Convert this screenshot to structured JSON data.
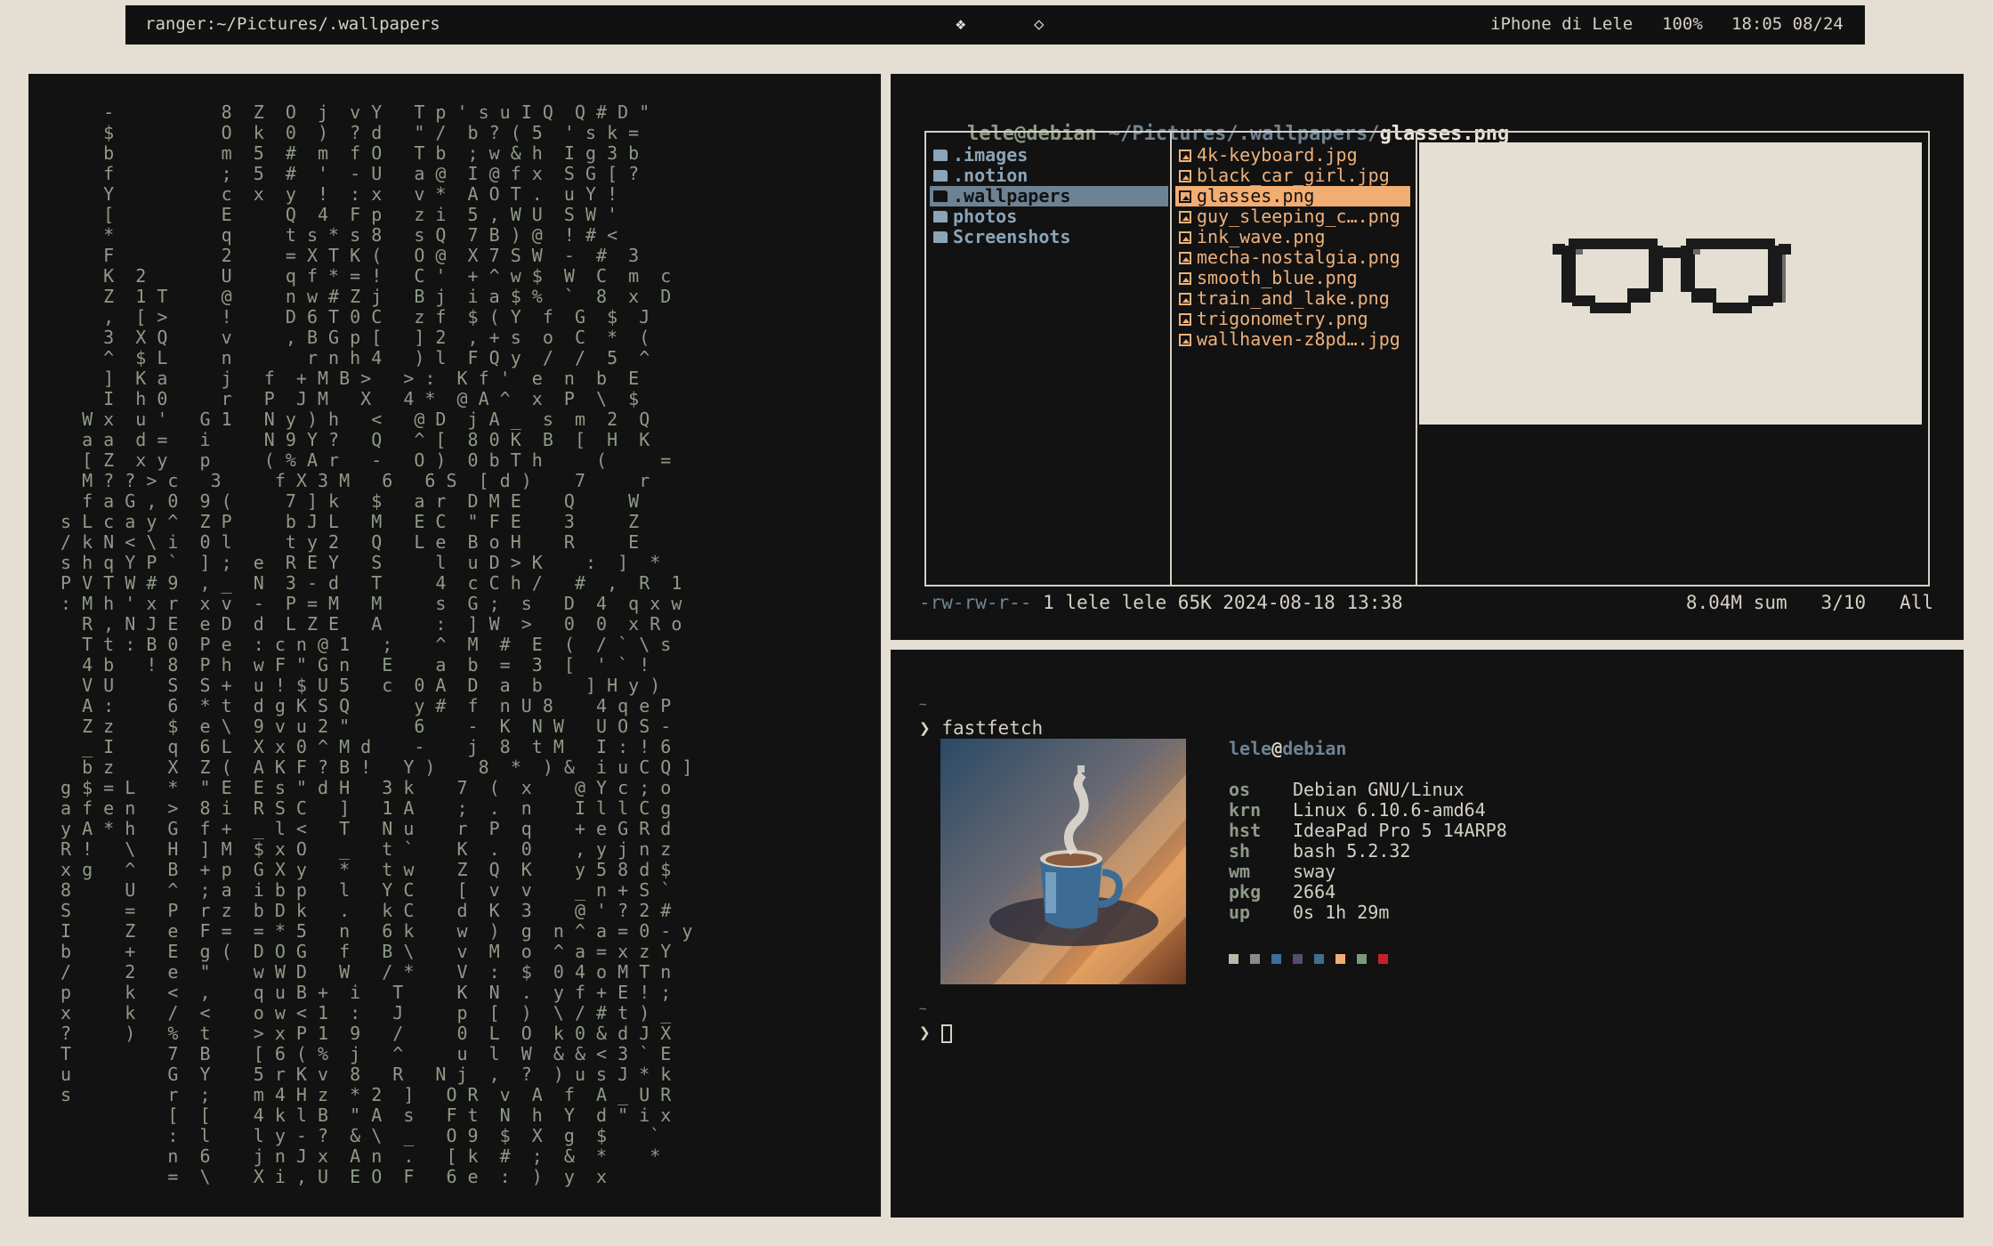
{
  "topbar": {
    "left": "ranger:~/Pictures/.wallpapers",
    "ws_icon_1": "❖",
    "ws_icon_2": "◇",
    "device": "iPhone di Lele",
    "battery": "100%",
    "clock": "18:05 08/24"
  },
  "matrix": {
    "lines": [
      "    -          8  Z  O  j  v Y   T p ' s u I Q  Q # D \"",
      "    $          O  k  0  )  ? d   \" /  b ? ( 5  ' s k =",
      "    b          m  5  #  m  f O   T b  ; w & h  I g 3 b",
      "    f          ;  5  #  '  - U   a @  I @ f x  S G [ ?",
      "    Y          c  x  y  !  : x   v *  A O T .  u Y !",
      "    [          E     Q  4  F p   z i  5 , W U  S W '",
      "    *          q     t s * s 8   s Q  7 B ) @  ! # <",
      "    F          2     = X T K (   O @  X 7 S W  -  #  3",
      "    K  2       U     q f * = !   C '  + ^ w $  W  C  m  c",
      "    Z  1 T     @     n w # Z j   B j  i a $ %  `  8  x  D",
      "    ,  [ >     !     D 6 T 0 C   z f  $ ( Y  f  G  $  J",
      "    3  X Q     v     , B G p [   ] 2  , + s  o  C  *  (",
      "    ^  $ L     n       r n h 4   ) l  F Q y  /  /  5  ^",
      "    ]  K a     j   f  + M B >   > :  K f '  e  n  b  E",
      "    I  h 0     r   P  J M   X   4 *  @ A ^  x  P  \\  $",
      "  W x  u '   G 1   N y ) h   <   @ D  j A _  s  m  2  Q",
      "  a a  d =   i     N 9 Y ?   Q   ^ [  8 0 K  B  [  H  K",
      "  [ Z  x y   p     ( % A r   -   O )  0 b T h     (     =",
      "  M ? ? > c   3     f X 3 M   6   6 S  [ d )    7     r",
      "  f a G , 0  9 (     7 ] k   $   a r  D M E    Q     W",
      "s L c a y ^  Z P     b J L   M   E C  \" F E    3     Z",
      "/ k N < \\ i  0 l     t y 2   Q   L e  B o H    R     E",
      "s h q Y P `  ] ;  e  R E Y   S     l  u D > K    :  ]  *",
      "P V T W # 9  , _  N  3 - d   T     4  c C h /   #  ,  R  1",
      ": M h ' x r  x v  -  P = M   M     s  G ;  s   D  4  q x w",
      "  R , N J E  e D  d  L Z E   A     :  ] W  >   0  0  x R o",
      "  T t : B 0  P e  : c n @ 1   ;    ^  M  #  E  (  / ` \\ s",
      "  4 b   ! 8  P h  w F \" G n   E    a  b  =  3  [  ' ` !",
      "  V U     S  S +  u ! $ U 5   c  0 A  D  a  b    ] H y )",
      "  A :     6  * t  d g K S Q      y #  f  n U 8    4 q e P",
      "  Z z     $  e \\  9 v u 2 \"      6    -  K  N W   U O S -",
      "  _ I     q  6 L  X x 0 ^ M d    -    j  8  t M   I : ! 6",
      "  b z     X  Z (  A K F ? B !   Y )    8  *  ) &  i u C Q ]",
      "g $ = L   *  \" E  E s \" d H   3 k    7  (  x    @ Y c ; o",
      "a f e n   >  8 i  R S C   ]   1 A    ;  .  n    I l l C g",
      "y A * h   G  f +  _ l <   T   N u    r  P  q    + e G R d",
      "R !   \\   H  ] M  $ x O   _   t `    K  .  0    , y j n z",
      "x g   ^   B  + p  G X y   *   t w    Z  Q  K    y 5 8 d $",
      "8     U   ^  ; a  i b p   l   Y C    [  v  v    _ n + S `",
      "S     =   P  r z  b D k   .   k C    d  K  3    @ ' ? 2 #",
      "I     Z   e  F =  = * 5   n   6 k    w  )  g  n ^ a = 0 - y",
      "b     +   E  g (  D O G   f   B \\    v  M  o  ^ a = x z Y",
      "/     2   e  \"    w W D   W   / *    V  :  $  0 4 o M T n",
      "p     k   <  ,    q u B +  i   T     K  N  .  y f + E ! ;",
      "x     k   /  <    o w < 1  :   J     p  [  )  \\ / # t ) _",
      "?     )   %  t    > x P 1  9   /     0  L  O  k 0 & d J X",
      "T         7  B    [ 6 ( %  j   ^     u  l  W  & & < 3 ` E",
      "u         G  Y    5 r K v  8   R   N j  ,  ?  ) u s J * k",
      "s         r  ;    m 4 H z  * 2  ]   O R  v  A  f  A _ U R",
      "          [  [    4 k l B  \" A  s   F t  N  h  Y  d \" i x",
      "          :  l    l y - ?  & \\  _   O 9  $  X  g  $    `",
      "          n  6    j n J x  A n  .   [ k  #  ;  &  *    *",
      "          =  \\    X i , U  E O  F   6 e  :  )  y  x"
    ]
  },
  "ranger": {
    "user": "lele@debian",
    "path": " ~/Pictures/.wallpapers/",
    "file": "glasses.png",
    "dirs": [
      ".images",
      ".notion",
      ".wallpapers",
      "photos",
      "Screenshots"
    ],
    "selected_dir_index": 2,
    "files": [
      "4k-keyboard.jpg",
      "black_car_girl.jpg",
      "glasses.png",
      "guy_sleeping_c….png",
      "ink_wave.png",
      "mecha-nostalgia.png",
      "smooth_blue.png",
      "train_and_lake.png",
      "trigonometry.png",
      "wallhaven-z8pd….jpg"
    ],
    "selected_file_index": 2,
    "status_perms": "-rw-rw-r--",
    "status_info": " 1 lele lele 65K 2024-08-18 13:38",
    "status_right": "8.04M sum   3/10   All"
  },
  "terminal": {
    "tilde": "~",
    "prompt_symbol": "❯",
    "command": "fastfetch",
    "ff_user": "lele",
    "ff_at": "@",
    "ff_host": "debian",
    "info": [
      {
        "key": "os",
        "value": "Debian GNU/Linux"
      },
      {
        "key": "krn",
        "value": "Linux 6.10.6-amd64"
      },
      {
        "key": "hst",
        "value": "IdeaPad Pro 5 14ARP8"
      },
      {
        "key": "sh",
        "value": "bash 5.2.32"
      },
      {
        "key": "wm",
        "value": "sway"
      },
      {
        "key": "pkg",
        "value": "2664"
      },
      {
        "key": "up",
        "value": "0s 1h 29m"
      }
    ],
    "palette": [
      "#bdb8ab",
      "#8c8a85",
      "#3a6e9e",
      "#5a4a6e",
      "#3f6f8a",
      "#f2ad72",
      "#7a9a7e",
      "#c8202a"
    ]
  },
  "colors": {
    "bg": "#e4dfd2",
    "terminal_bg": "#121212",
    "matrix_green": "#8e9a86",
    "ranger_blue": "#8aa4b8",
    "ranger_orange": "#eeb17c"
  }
}
